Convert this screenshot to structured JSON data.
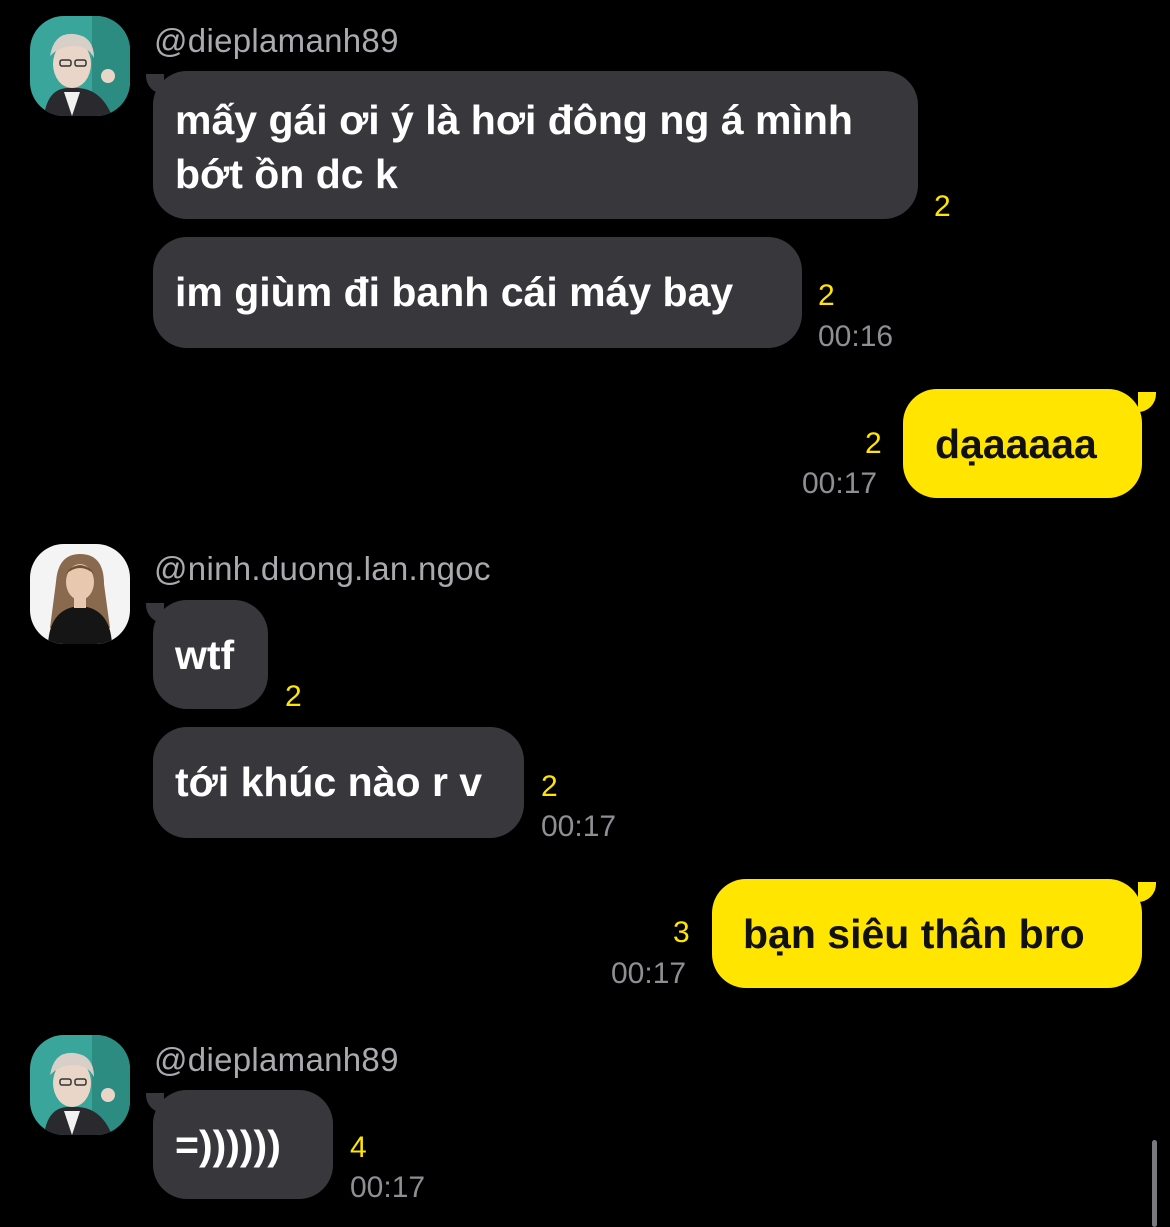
{
  "chat": {
    "groups": [
      {
        "sender": "@dieplamanh89",
        "avatar_icon": "avatar-dieplamanh89",
        "messages": [
          {
            "lines": [
              "mấy gái ơi ý là hơi đông ng á mình",
              "bớt ồn dc k"
            ],
            "unread": "2"
          },
          {
            "text": "im giùm đi banh cái máy bay",
            "unread": "2",
            "time": "00:16"
          }
        ]
      },
      {
        "sender": "me",
        "messages": [
          {
            "text": "dạaaaaa",
            "unread": "2",
            "time": "00:17"
          }
        ]
      },
      {
        "sender": "@ninh.duong.lan.ngoc",
        "avatar_icon": "avatar-ninh-duong-lan-ngoc",
        "messages": [
          {
            "text": "wtf",
            "unread": "2"
          },
          {
            "text": "tới khúc nào r v",
            "unread": "2",
            "time": "00:17"
          }
        ]
      },
      {
        "sender": "me",
        "messages": [
          {
            "text": "bạn siêu thân bro",
            "unread": "3",
            "time": "00:17"
          }
        ]
      },
      {
        "sender": "@dieplamanh89",
        "avatar_icon": "avatar-dieplamanh89",
        "messages": [
          {
            "text": "=))))))",
            "unread": "4",
            "time": "00:17"
          }
        ]
      }
    ]
  },
  "colors": {
    "background": "#000000",
    "incoming_bubble": "#38383c",
    "outgoing_bubble": "#ffe500",
    "unread_count": "#ffe500",
    "timestamp": "#8e8e93",
    "username": "#a9a9ae"
  }
}
